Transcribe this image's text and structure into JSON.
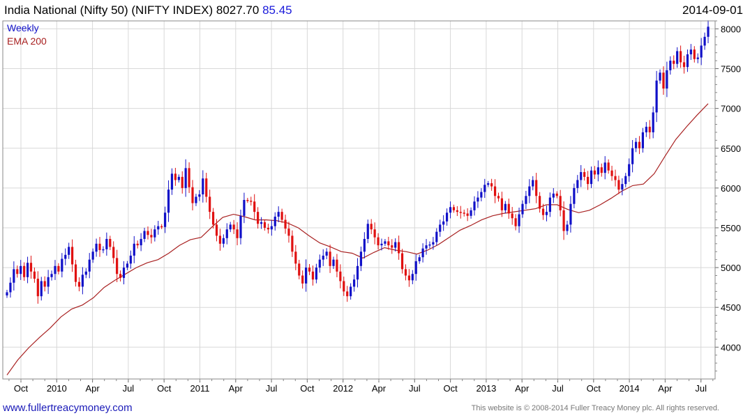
{
  "header": {
    "title": "India National (Nifty 50) (NIFTY INDEX) 8027.70",
    "change": "85.45",
    "date": "2014-09-01"
  },
  "footer": {
    "site_link": "www.fullertreacymoney.com",
    "copyright": "This website is © 2008-2014 Fuller Treacy Money plc. All rights reserved."
  },
  "colors": {
    "up": "#1010c8",
    "down": "#e01010",
    "ema": "#a82020",
    "grid": "#d8d8d8"
  },
  "chart_data": {
    "type": "candlestick",
    "legend": [
      {
        "name": "Weekly",
        "color": "#1010c8"
      },
      {
        "name": "EMA 200",
        "color": "#a82020"
      }
    ],
    "ylim": [
      3600,
      8100
    ],
    "y_ticks": [
      4000,
      4500,
      5000,
      5500,
      6000,
      6500,
      7000,
      7500,
      8000
    ],
    "x_ticks": [
      "Oct",
      "2010",
      "Apr",
      "Jul",
      "Oct",
      "2011",
      "Apr",
      "Jul",
      "Oct",
      "2012",
      "Apr",
      "Jul",
      "Oct",
      "2013",
      "Apr",
      "Jul",
      "Oct",
      "2014",
      "Apr",
      "Jul"
    ],
    "weekly_close": [
      4690,
      4810,
      4980,
      4920,
      5020,
      4880,
      5060,
      4950,
      4860,
      4640,
      4830,
      4760,
      4880,
      4920,
      5020,
      4950,
      5110,
      5160,
      5260,
      5040,
      4820,
      4760,
      4910,
      4950,
      5100,
      5200,
      5300,
      5220,
      5230,
      5360,
      5260,
      5120,
      4920,
      4870,
      5000,
      5050,
      5150,
      5300,
      5280,
      5360,
      5460,
      5410,
      5380,
      5480,
      5520,
      5510,
      5690,
      5980,
      6180,
      6100,
      6140,
      6000,
      6250,
      6010,
      5810,
      5890,
      5920,
      6120,
      5890,
      5700,
      5540,
      5400,
      5300,
      5370,
      5480,
      5540,
      5480,
      5370,
      5650,
      5850,
      5840,
      5830,
      5700,
      5550,
      5570,
      5500,
      5480,
      5520,
      5640,
      5700,
      5600,
      5490,
      5400,
      5200,
      5050,
      4900,
      4800,
      5000,
      4950,
      4850,
      5000,
      5100,
      5150,
      5200,
      5020,
      5100,
      4950,
      4830,
      4700,
      4640,
      4760,
      4850,
      5020,
      5200,
      5360,
      5550,
      5480,
      5380,
      5280,
      5300,
      5330,
      5280,
      5250,
      5320,
      5180,
      4980,
      4900,
      4840,
      4920,
      5080,
      5130,
      5240,
      5280,
      5290,
      5320,
      5450,
      5540,
      5580,
      5690,
      5760,
      5720,
      5700,
      5690,
      5680,
      5650,
      5720,
      5830,
      5880,
      5950,
      6040,
      6060,
      6020,
      5900,
      5870,
      5720,
      5800,
      5680,
      5620,
      5520,
      5670,
      5800,
      5900,
      6020,
      6100,
      5900,
      5740,
      5660,
      5700,
      5880,
      5930,
      5900,
      5720,
      5460,
      5540,
      5800,
      6000,
      6100,
      6200,
      6140,
      6050,
      6220,
      6170,
      6260,
      6190,
      6320,
      6220,
      6150,
      6100,
      5980,
      6050,
      6150,
      6300,
      6500,
      6580,
      6500,
      6700,
      6770,
      6700,
      6950,
      7350,
      7450,
      7250,
      7480,
      7600,
      7560,
      7720,
      7580,
      7520,
      7680,
      7740,
      7620,
      7640,
      7790,
      7900,
      8027
    ],
    "ema200": [
      3650,
      3840,
      3990,
      4120,
      4240,
      4380,
      4480,
      4530,
      4620,
      4750,
      4840,
      4920,
      5000,
      5060,
      5100,
      5180,
      5280,
      5350,
      5380,
      5510,
      5630,
      5670,
      5640,
      5600,
      5600,
      5590,
      5560,
      5500,
      5400,
      5310,
      5260,
      5200,
      5180,
      5120,
      5190,
      5250,
      5220,
      5200,
      5170,
      5220,
      5290,
      5380,
      5470,
      5530,
      5600,
      5650,
      5680,
      5700,
      5720,
      5740,
      5790,
      5790,
      5730,
      5690,
      5720,
      5790,
      5870,
      5960,
      6030,
      6050,
      6180,
      6400,
      6610,
      6770,
      6920,
      7060
    ]
  }
}
